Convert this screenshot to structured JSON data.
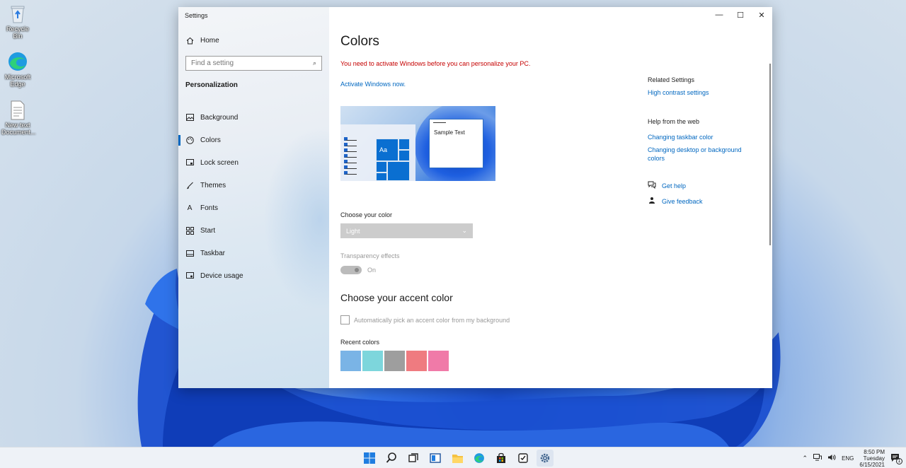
{
  "desktop": {
    "icons": [
      {
        "label": "Recycle Bin",
        "icon": "recycle-bin-icon"
      },
      {
        "label": "Microsoft Edge",
        "icon": "edge-icon"
      },
      {
        "label": "New text Document...",
        "icon": "text-file-icon"
      }
    ]
  },
  "window": {
    "title": "Settings",
    "controls": {
      "minimize": "—",
      "maximize": "☐",
      "close": "✕"
    }
  },
  "sidebar": {
    "home_label": "Home",
    "search_placeholder": "Find a setting",
    "section": "Personalization",
    "items": [
      {
        "label": "Background",
        "icon": "image-icon"
      },
      {
        "label": "Colors",
        "icon": "palette-icon",
        "active": true
      },
      {
        "label": "Lock screen",
        "icon": "lock-screen-icon"
      },
      {
        "label": "Themes",
        "icon": "brush-icon"
      },
      {
        "label": "Fonts",
        "icon": "font-icon"
      },
      {
        "label": "Start",
        "icon": "start-icon"
      },
      {
        "label": "Taskbar",
        "icon": "taskbar-icon"
      },
      {
        "label": "Device usage",
        "icon": "device-icon"
      }
    ]
  },
  "main": {
    "title": "Colors",
    "activation_warning": "You need to activate Windows before you can personalize your PC.",
    "activate_link": "Activate Windows now.",
    "preview": {
      "tile_text": "Aa",
      "sample_text": "Sample Text"
    },
    "choose_color_label": "Choose your color",
    "choose_color_value": "Light",
    "transparency_label": "Transparency effects",
    "transparency_value": "On",
    "accent_heading": "Choose your accent color",
    "auto_pick_label": "Automatically pick an accent color from my background",
    "recent_colors_label": "Recent colors",
    "recent_colors": [
      "#7ab4e6",
      "#7dd6dc",
      "#9e9e9e",
      "#ef7b80",
      "#f07aa8"
    ]
  },
  "related": {
    "heading": "Related Settings",
    "links": [
      "High contrast settings"
    ],
    "help_heading": "Help from the web",
    "help_links": [
      "Changing taskbar color",
      "Changing desktop or background colors"
    ],
    "get_help": "Get help",
    "give_feedback": "Give feedback"
  },
  "taskbar": {
    "apps": [
      "start-icon",
      "search-icon",
      "task-view-icon",
      "widgets-icon",
      "file-explorer-icon",
      "edge-icon",
      "store-icon",
      "todo-icon",
      "settings-icon"
    ],
    "tray": {
      "language": "ENG",
      "time": "8:50 PM",
      "day": "Tuesday",
      "date": "6/15/2021",
      "notification_count": "1"
    }
  },
  "colors": {
    "accent": "#0067c0",
    "warning": "#c50000"
  }
}
